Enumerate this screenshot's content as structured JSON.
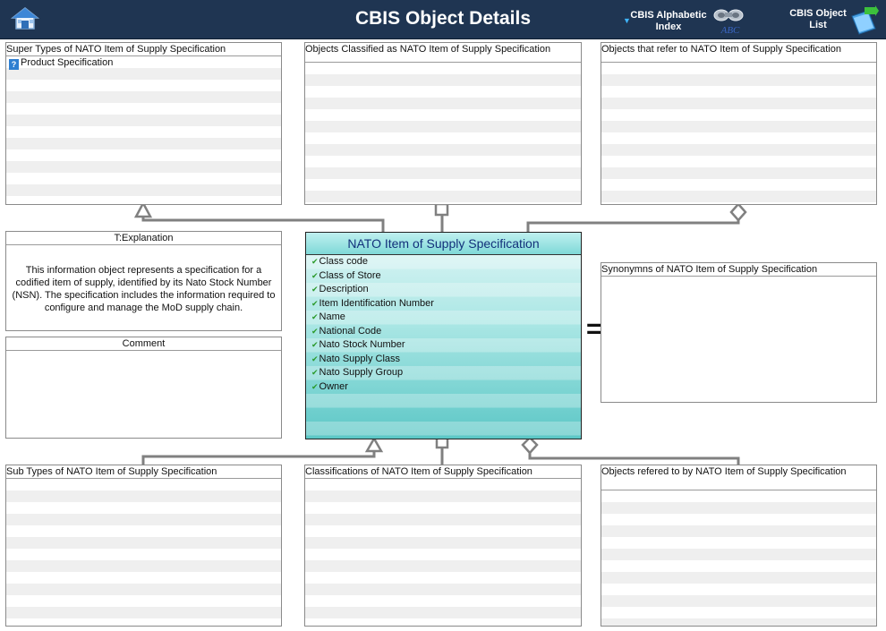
{
  "header": {
    "title": "CBIS Object Details",
    "alphabetic_index_label": "CBIS Alphabetic Index",
    "object_list_label": "CBIS Object List",
    "alpha_icon_text": "ABC",
    "colors": {
      "header_bg": "#1f3552",
      "title_text": "#ffffff"
    }
  },
  "panels": {
    "super_types": {
      "title": "Super Types of NATO Item of Supply Specification",
      "items": [
        {
          "label": "Product Specification",
          "icon": "question-icon"
        }
      ]
    },
    "classified_as": {
      "title": "Objects Classified as  NATO Item of Supply Specification",
      "items": []
    },
    "refer_to": {
      "title": "Objects that refer to   NATO Item of Supply Specification",
      "items": []
    },
    "explanation": {
      "title": "T:Explanation",
      "text": "This information object represents a specification for a codified item of supply, identified by its Nato Stock Number (NSN).  The specification includes the information required to configure and manage the MoD supply chain."
    },
    "comment": {
      "title": "Comment",
      "text": ""
    },
    "synonyms": {
      "title": "Synonymns   of NATO Item of Supply Specification",
      "items": []
    },
    "sub_types": {
      "title": "Sub Types of NATO Item of Supply Specification",
      "items": []
    },
    "classifications": {
      "title": "Classifications of NATO Item of Supply Specification",
      "items": []
    },
    "refered_by": {
      "title": "Objects refered to by   NATO Item of Supply Specification",
      "items": []
    }
  },
  "class_box": {
    "title": "NATO Item of Supply Specification",
    "attributes": [
      "Class code",
      "Class of Store",
      "Description",
      "Item Identification Number",
      "Name",
      "National Code",
      "Nato Stock Number",
      "Nato Supply Class",
      "Nato Supply Group",
      "Owner"
    ],
    "colors": {
      "title_text": "#12307a",
      "fill_top": "#dff6f6",
      "fill_bottom": "#5cc7c6",
      "attribute_tick": "#2b9a2b"
    }
  },
  "equals_symbol": "=",
  "connector_color": "#808080"
}
